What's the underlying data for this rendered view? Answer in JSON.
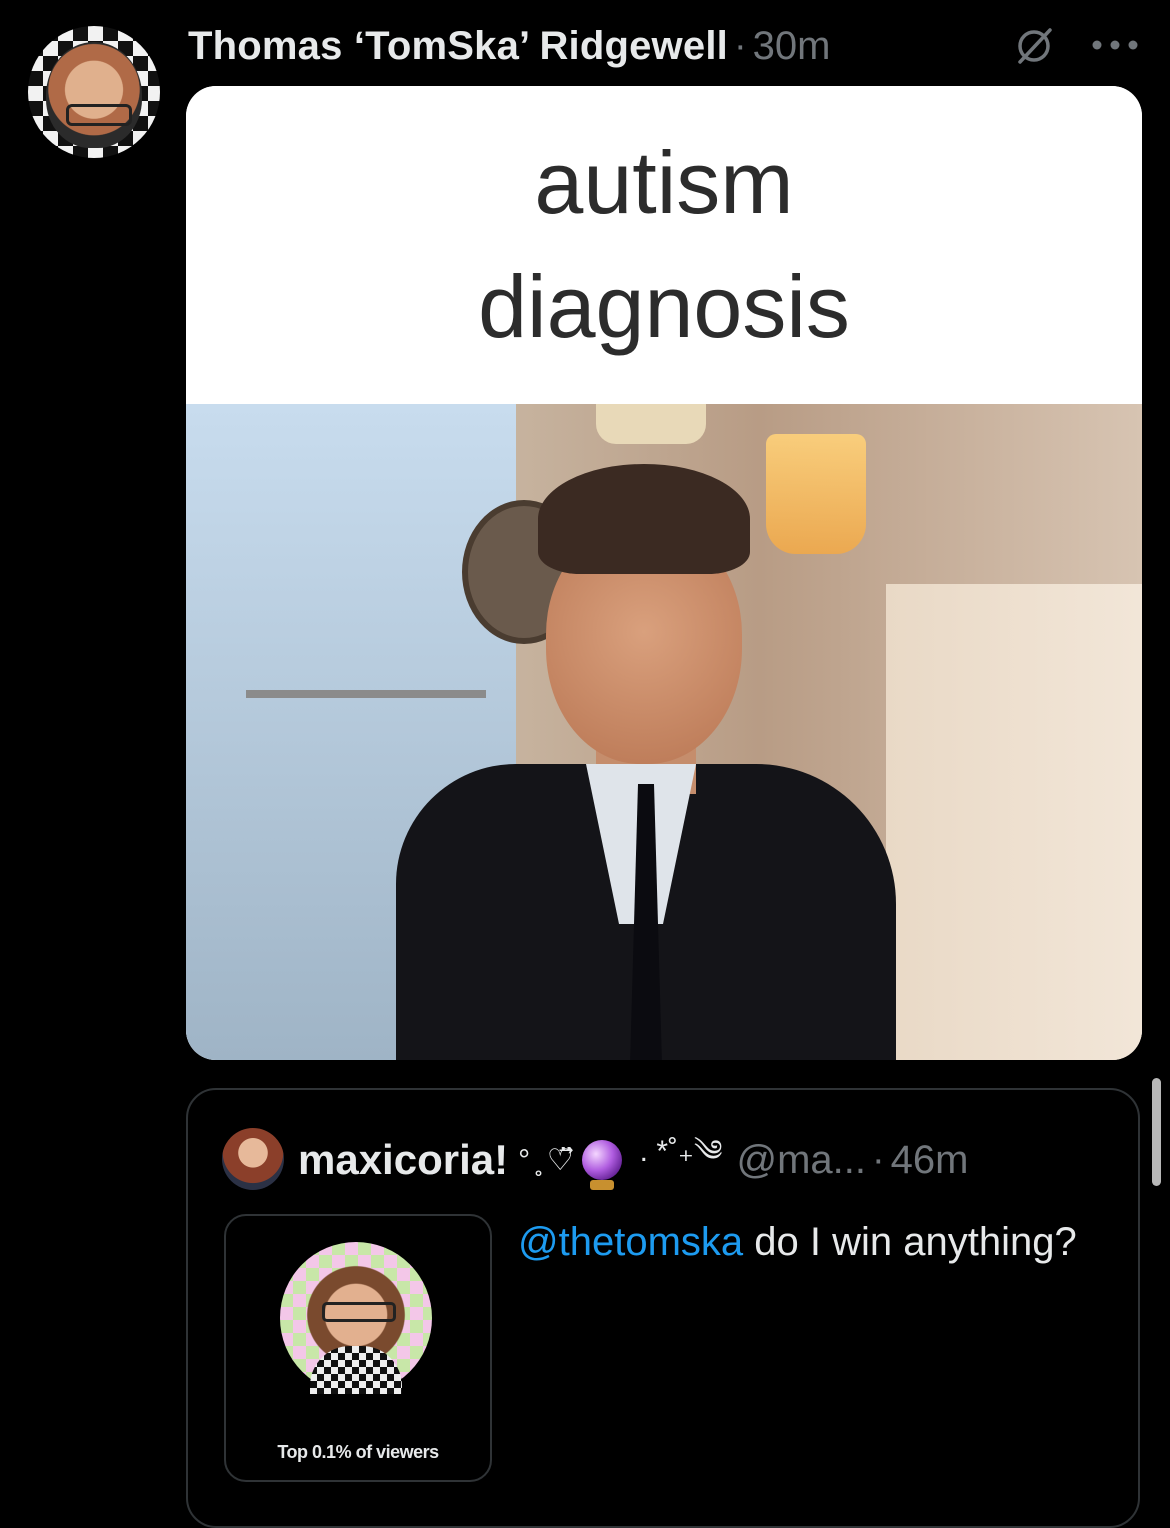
{
  "post": {
    "author": "Thomas ‘TomSka’ Ridgewell",
    "separator": "·",
    "time": "30m",
    "icons": [
      "grok-icon",
      "more-icon"
    ],
    "meme_caption": [
      "autism",
      "diagnosis"
    ]
  },
  "quote": {
    "name": "maxicoria!",
    "decor_before": "° ̥ ♡̈⃗",
    "decor_after": ". *˚₊༄",
    "handle": "@ma...",
    "separator": "·",
    "time": "46m",
    "mention": "@thetomska",
    "text_rest": " do I win anything?",
    "card_label": "Top 0.1% of viewers"
  },
  "colors": {
    "background": "#000000",
    "text": "#e7e9ea",
    "muted": "#71767b",
    "link": "#1d9bf0",
    "border": "#2f3336"
  }
}
